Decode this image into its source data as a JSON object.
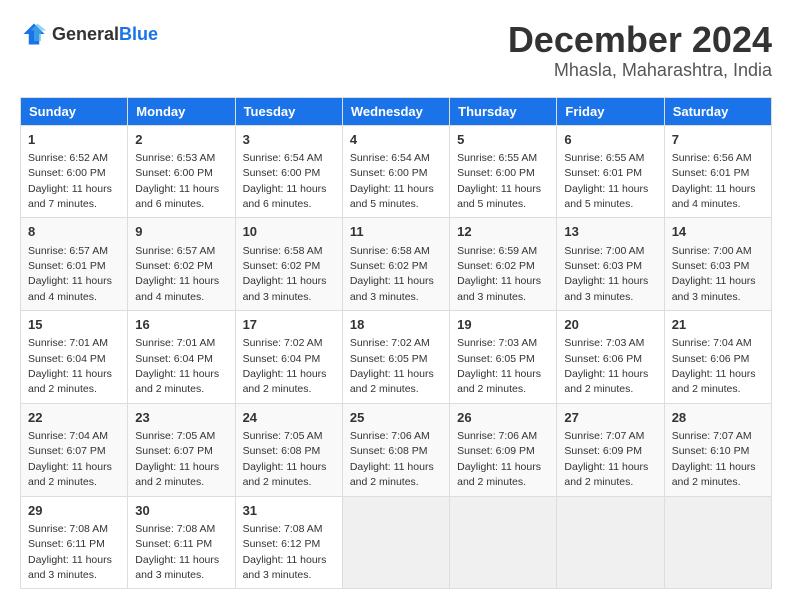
{
  "header": {
    "logo_general": "General",
    "logo_blue": "Blue",
    "month": "December 2024",
    "location": "Mhasla, Maharashtra, India"
  },
  "days_of_week": [
    "Sunday",
    "Monday",
    "Tuesday",
    "Wednesday",
    "Thursday",
    "Friday",
    "Saturday"
  ],
  "weeks": [
    [
      {
        "day": "1",
        "info": "Sunrise: 6:52 AM\nSunset: 6:00 PM\nDaylight: 11 hours and 7 minutes."
      },
      {
        "day": "2",
        "info": "Sunrise: 6:53 AM\nSunset: 6:00 PM\nDaylight: 11 hours and 6 minutes."
      },
      {
        "day": "3",
        "info": "Sunrise: 6:54 AM\nSunset: 6:00 PM\nDaylight: 11 hours and 6 minutes."
      },
      {
        "day": "4",
        "info": "Sunrise: 6:54 AM\nSunset: 6:00 PM\nDaylight: 11 hours and 5 minutes."
      },
      {
        "day": "5",
        "info": "Sunrise: 6:55 AM\nSunset: 6:00 PM\nDaylight: 11 hours and 5 minutes."
      },
      {
        "day": "6",
        "info": "Sunrise: 6:55 AM\nSunset: 6:01 PM\nDaylight: 11 hours and 5 minutes."
      },
      {
        "day": "7",
        "info": "Sunrise: 6:56 AM\nSunset: 6:01 PM\nDaylight: 11 hours and 4 minutes."
      }
    ],
    [
      {
        "day": "8",
        "info": "Sunrise: 6:57 AM\nSunset: 6:01 PM\nDaylight: 11 hours and 4 minutes."
      },
      {
        "day": "9",
        "info": "Sunrise: 6:57 AM\nSunset: 6:02 PM\nDaylight: 11 hours and 4 minutes."
      },
      {
        "day": "10",
        "info": "Sunrise: 6:58 AM\nSunset: 6:02 PM\nDaylight: 11 hours and 3 minutes."
      },
      {
        "day": "11",
        "info": "Sunrise: 6:58 AM\nSunset: 6:02 PM\nDaylight: 11 hours and 3 minutes."
      },
      {
        "day": "12",
        "info": "Sunrise: 6:59 AM\nSunset: 6:02 PM\nDaylight: 11 hours and 3 minutes."
      },
      {
        "day": "13",
        "info": "Sunrise: 7:00 AM\nSunset: 6:03 PM\nDaylight: 11 hours and 3 minutes."
      },
      {
        "day": "14",
        "info": "Sunrise: 7:00 AM\nSunset: 6:03 PM\nDaylight: 11 hours and 3 minutes."
      }
    ],
    [
      {
        "day": "15",
        "info": "Sunrise: 7:01 AM\nSunset: 6:04 PM\nDaylight: 11 hours and 2 minutes."
      },
      {
        "day": "16",
        "info": "Sunrise: 7:01 AM\nSunset: 6:04 PM\nDaylight: 11 hours and 2 minutes."
      },
      {
        "day": "17",
        "info": "Sunrise: 7:02 AM\nSunset: 6:04 PM\nDaylight: 11 hours and 2 minutes."
      },
      {
        "day": "18",
        "info": "Sunrise: 7:02 AM\nSunset: 6:05 PM\nDaylight: 11 hours and 2 minutes."
      },
      {
        "day": "19",
        "info": "Sunrise: 7:03 AM\nSunset: 6:05 PM\nDaylight: 11 hours and 2 minutes."
      },
      {
        "day": "20",
        "info": "Sunrise: 7:03 AM\nSunset: 6:06 PM\nDaylight: 11 hours and 2 minutes."
      },
      {
        "day": "21",
        "info": "Sunrise: 7:04 AM\nSunset: 6:06 PM\nDaylight: 11 hours and 2 minutes."
      }
    ],
    [
      {
        "day": "22",
        "info": "Sunrise: 7:04 AM\nSunset: 6:07 PM\nDaylight: 11 hours and 2 minutes."
      },
      {
        "day": "23",
        "info": "Sunrise: 7:05 AM\nSunset: 6:07 PM\nDaylight: 11 hours and 2 minutes."
      },
      {
        "day": "24",
        "info": "Sunrise: 7:05 AM\nSunset: 6:08 PM\nDaylight: 11 hours and 2 minutes."
      },
      {
        "day": "25",
        "info": "Sunrise: 7:06 AM\nSunset: 6:08 PM\nDaylight: 11 hours and 2 minutes."
      },
      {
        "day": "26",
        "info": "Sunrise: 7:06 AM\nSunset: 6:09 PM\nDaylight: 11 hours and 2 minutes."
      },
      {
        "day": "27",
        "info": "Sunrise: 7:07 AM\nSunset: 6:09 PM\nDaylight: 11 hours and 2 minutes."
      },
      {
        "day": "28",
        "info": "Sunrise: 7:07 AM\nSunset: 6:10 PM\nDaylight: 11 hours and 2 minutes."
      }
    ],
    [
      {
        "day": "29",
        "info": "Sunrise: 7:08 AM\nSunset: 6:11 PM\nDaylight: 11 hours and 3 minutes."
      },
      {
        "day": "30",
        "info": "Sunrise: 7:08 AM\nSunset: 6:11 PM\nDaylight: 11 hours and 3 minutes."
      },
      {
        "day": "31",
        "info": "Sunrise: 7:08 AM\nSunset: 6:12 PM\nDaylight: 11 hours and 3 minutes."
      },
      null,
      null,
      null,
      null
    ]
  ]
}
